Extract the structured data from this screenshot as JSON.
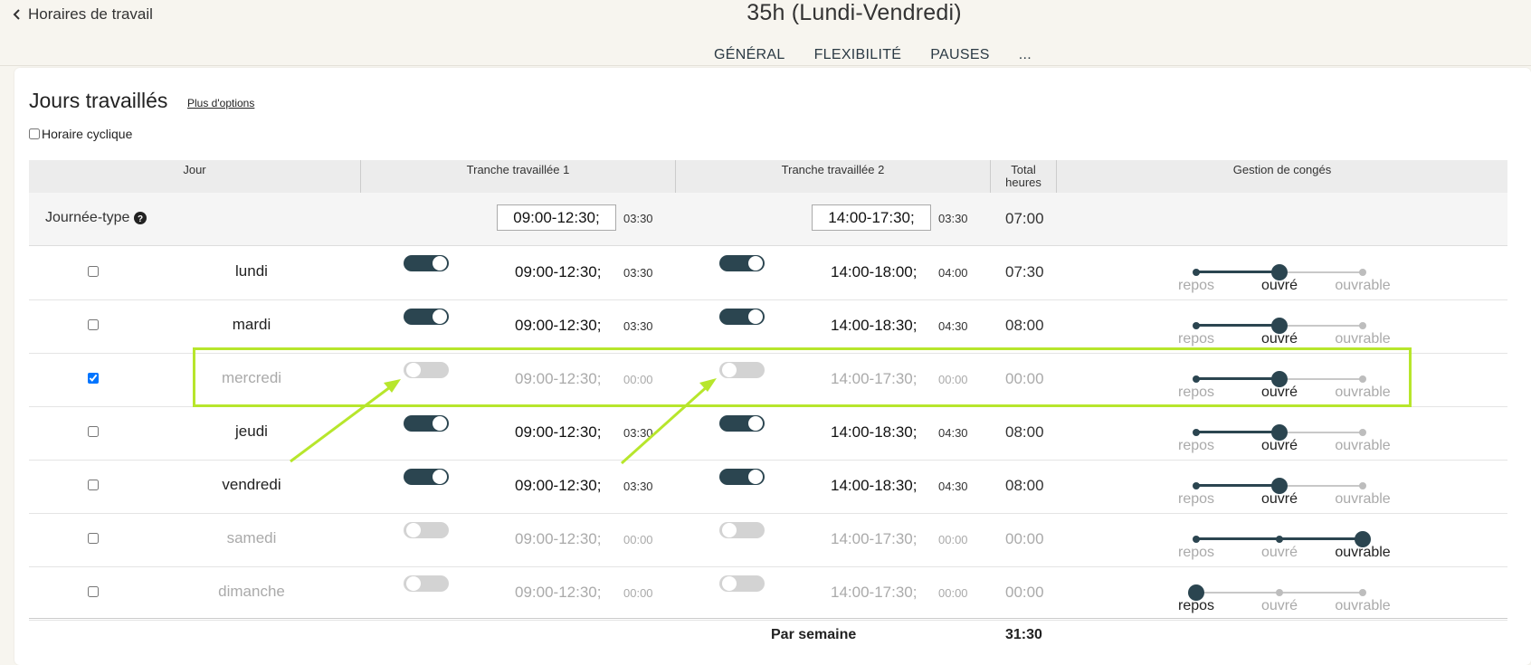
{
  "header": {
    "back_label": "Horaires de travail",
    "title": "35h (Lundi-Vendredi)",
    "tabs": [
      "GÉNÉRAL",
      "FLEXIBILITÉ",
      "PAUSES",
      "..."
    ]
  },
  "section": {
    "heading": "Jours travaillés",
    "more_options": "Plus d'options",
    "cyclic_label": "Horaire cyclique",
    "cyclic_checked": false
  },
  "table": {
    "headers": {
      "jour": "Jour",
      "slot1": "Tranche travaillée 1",
      "slot2": "Tranche travaillée 2",
      "total_line1": "Total",
      "total_line2": "heures",
      "conges": "Gestion de congés"
    },
    "typical_day": {
      "label": "Journée-type",
      "slot1": "09:00-12:30;",
      "slot1_duration": "03:30",
      "slot2": "14:00-17:30;",
      "slot2_duration": "03:30",
      "total": "07:00"
    },
    "leave_labels": [
      "repos",
      "ouvré",
      "ouvrable"
    ],
    "rows": [
      {
        "day": "lundi",
        "checked": false,
        "slot1_on": true,
        "slot1": "09:00-12:30;",
        "slot1_duration": "03:30",
        "slot2_on": true,
        "slot2": "14:00-18:00;",
        "slot2_duration": "04:00",
        "total": "07:30",
        "leave": "ouvré"
      },
      {
        "day": "mardi",
        "checked": false,
        "slot1_on": true,
        "slot1": "09:00-12:30;",
        "slot1_duration": "03:30",
        "slot2_on": true,
        "slot2": "14:00-18:30;",
        "slot2_duration": "04:30",
        "total": "08:00",
        "leave": "ouvré"
      },
      {
        "day": "mercredi",
        "checked": true,
        "slot1_on": false,
        "slot1": "09:00-12:30;",
        "slot1_duration": "00:00",
        "slot2_on": false,
        "slot2": "14:00-17:30;",
        "slot2_duration": "00:00",
        "total": "00:00",
        "leave": "ouvré"
      },
      {
        "day": "jeudi",
        "checked": false,
        "slot1_on": true,
        "slot1": "09:00-12:30;",
        "slot1_duration": "03:30",
        "slot2_on": true,
        "slot2": "14:00-18:30;",
        "slot2_duration": "04:30",
        "total": "08:00",
        "leave": "ouvré"
      },
      {
        "day": "vendredi",
        "checked": false,
        "slot1_on": true,
        "slot1": "09:00-12:30;",
        "slot1_duration": "03:30",
        "slot2_on": true,
        "slot2": "14:00-18:30;",
        "slot2_duration": "04:30",
        "total": "08:00",
        "leave": "ouvré"
      },
      {
        "day": "samedi",
        "checked": false,
        "slot1_on": false,
        "slot1": "09:00-12:30;",
        "slot1_duration": "00:00",
        "slot2_on": false,
        "slot2": "14:00-17:30;",
        "slot2_duration": "00:00",
        "total": "00:00",
        "leave": "ouvrable"
      },
      {
        "day": "dimanche",
        "checked": false,
        "slot1_on": false,
        "slot1": "09:00-12:30;",
        "slot1_duration": "00:00",
        "slot2_on": false,
        "slot2": "14:00-17:30;",
        "slot2_duration": "00:00",
        "total": "00:00",
        "leave": "repos"
      }
    ],
    "footer": {
      "label": "Par semaine",
      "total": "31:30"
    }
  },
  "colors": {
    "toggle_on": "#2b4550",
    "toggle_off": "#d3d3d3",
    "highlight": "#b7e62c",
    "disabled_text": "#aaaaaa"
  },
  "annotations": {
    "highlighted_row": "mercredi",
    "arrow_targets": [
      "slot1-toggle",
      "slot2-toggle"
    ]
  }
}
